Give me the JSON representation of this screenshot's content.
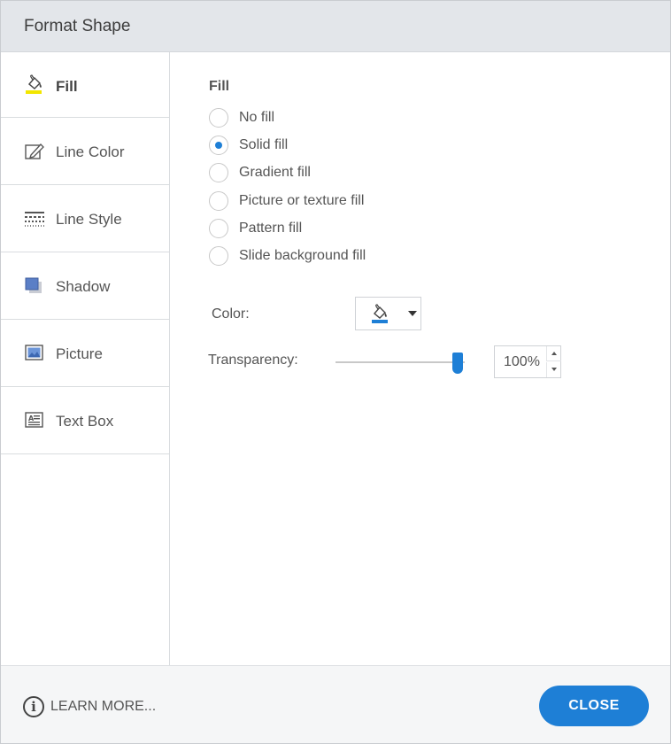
{
  "dialog": {
    "title": "Format Shape"
  },
  "sidebar": {
    "items": [
      {
        "label": "Fill",
        "icon": "paint-bucket-icon",
        "active": true
      },
      {
        "label": "Line Color",
        "icon": "pencil-square-icon",
        "active": false
      },
      {
        "label": "Line Style",
        "icon": "line-style-icon",
        "active": false
      },
      {
        "label": "Shadow",
        "icon": "shadow-square-icon",
        "active": false
      },
      {
        "label": "Picture",
        "icon": "picture-icon",
        "active": false
      },
      {
        "label": "Text Box",
        "icon": "text-box-icon",
        "active": false
      }
    ]
  },
  "fill": {
    "section_title": "Fill",
    "options": [
      {
        "label": "No fill",
        "selected": false
      },
      {
        "label": "Solid fill",
        "selected": true
      },
      {
        "label": "Gradient fill",
        "selected": false
      },
      {
        "label": "Picture or texture fill",
        "selected": false
      },
      {
        "label": "Pattern fill",
        "selected": false
      },
      {
        "label": "Slide background fill",
        "selected": false
      }
    ],
    "color_label": "Color:",
    "color_icon": "paint-bucket-icon",
    "transparency_label": "Transparency:",
    "transparency_value": "100%",
    "transparency_fraction": 1.0
  },
  "footer": {
    "learn_more_label": "LEARN MORE...",
    "close_label": "CLOSE"
  },
  "colors": {
    "accent": "#1e7fd6",
    "titlebar": "#e3e6ea",
    "fill_highlight": "#f2e600"
  }
}
